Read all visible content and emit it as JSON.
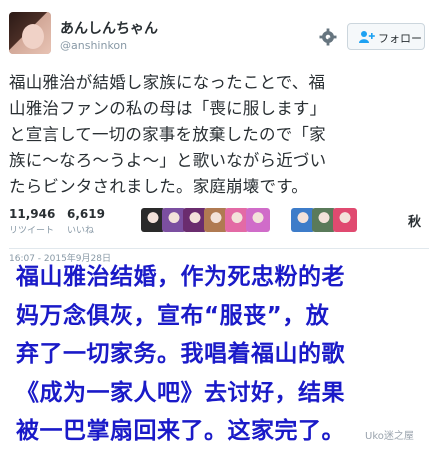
{
  "profile": {
    "name": "あんしんちゃん",
    "handle": "@anshinkon",
    "gear_icon": "gear-icon",
    "follow_label": "フォロー",
    "follow_icon": "add-user-icon"
  },
  "tweet": {
    "lines": [
      "福山雅治が結婚し家族になったことで、福",
      "山雅治ファンの私の母は「喪に服します」",
      "と宣言して一切の家事を放棄したので「家",
      "族に～なろ～うよ～」と歌いながら近づい",
      "たらビンタされました。家庭崩壊です。"
    ]
  },
  "stats": {
    "retweets": {
      "value": "11,946",
      "label": "リツイート"
    },
    "likes": {
      "value": "6,619",
      "label": "いいね"
    },
    "liker_tag": "秋",
    "liker_colors": [
      "#2a2a2a",
      "#7b4fa0",
      "#6a2c6e",
      "#b07a52",
      "#e36aa5",
      "#d06cc9",
      "#3d7cc9",
      "#5a7a5a",
      "#e04a70",
      "#9a6aa8"
    ]
  },
  "timestamp": "16:07 - 2015年9月28日",
  "translation": {
    "lines": [
      "福山雅治结婚，作为死忠粉的老",
      "妈万念俱灰，宣布“服丧”，放",
      "弃了一切家务。我唱着福山的歌",
      "《成为一家人吧》去讨好，结果",
      "被一巴掌扇回来了。这家完了。"
    ]
  },
  "watermark": "Uko迷之屋"
}
